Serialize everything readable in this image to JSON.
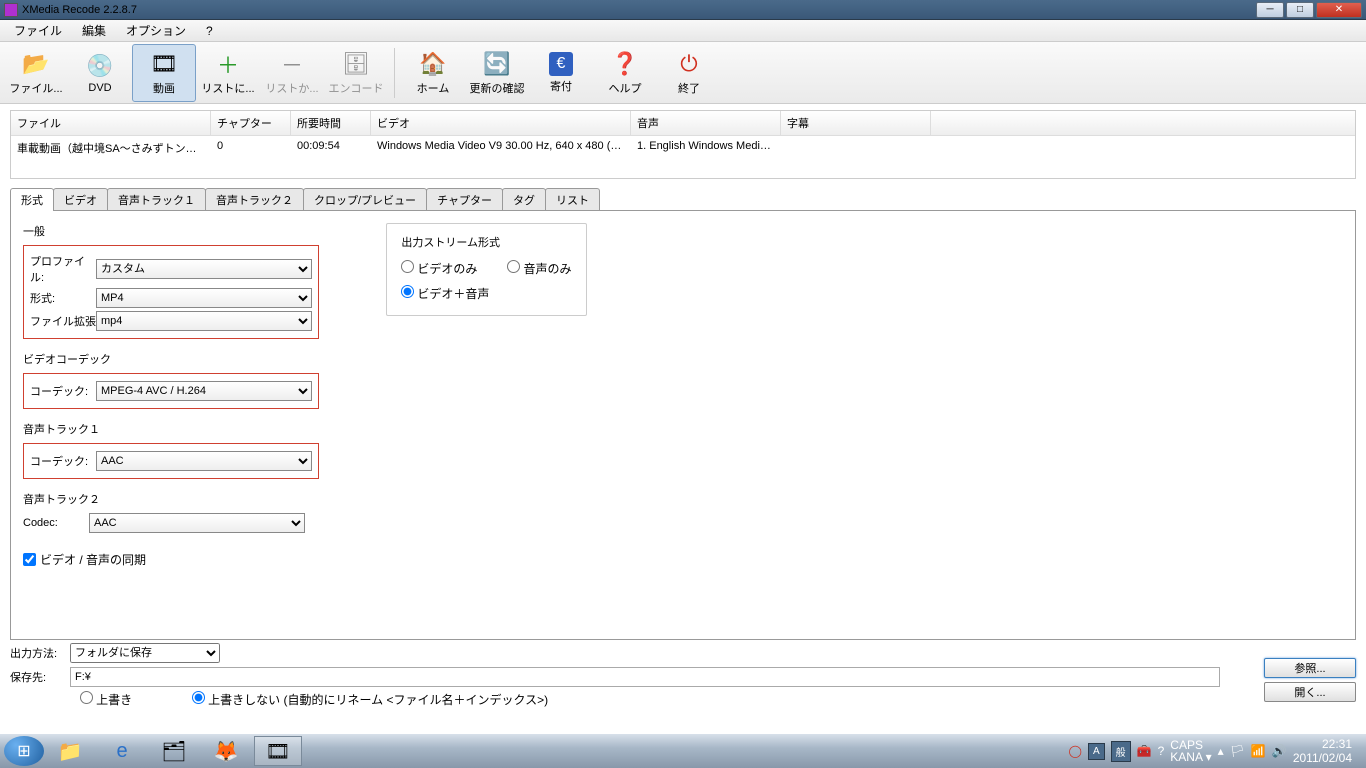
{
  "titlebar": {
    "title": "XMedia Recode 2.2.8.7"
  },
  "menu": {
    "file": "ファイル",
    "edit": "編集",
    "options": "オプション",
    "help": "?"
  },
  "toolbar": {
    "file": "ファイル...",
    "dvd": "DVD",
    "movie": "動画",
    "addlist": "リストに...",
    "removelist": "リストか...",
    "encode": "エンコード",
    "home": "ホーム",
    "update": "更新の確認",
    "donate": "寄付",
    "help": "ヘルプ",
    "exit": "終了"
  },
  "filelist": {
    "headers": {
      "file": "ファイル",
      "chapter": "チャプター",
      "time": "所要時間",
      "video": "ビデオ",
      "audio": "音声",
      "subs": "字幕"
    },
    "rows": [
      {
        "file": "車載動画（越中境SA～さみずトンネ...",
        "chapter": "0",
        "time": "00:09:54",
        "video": "Windows Media Video V9 30.00 Hz, 640 x 480 (1...",
        "audio": "1. English Windows Media ...",
        "subs": ""
      }
    ]
  },
  "tabs": {
    "format": "形式",
    "video": "ビデオ",
    "atrack1": "音声トラック１",
    "atrack2": "音声トラック２",
    "crop": "クロップ/プレビュー",
    "chapter": "チャプター",
    "tag": "タグ",
    "list": "リスト"
  },
  "format_panel": {
    "general_title": "一般",
    "profile_label": "プロファイル:",
    "profile_value": "カスタム",
    "format_label": "形式:",
    "format_value": "MP4",
    "ext_label": "ファイル拡張",
    "ext_value": "mp4",
    "vcodec_title": "ビデオコーデック",
    "codec_label": "コーデック:",
    "vcodec_value": "MPEG-4 AVC / H.264",
    "atrack1_title": "音声トラック１",
    "acodec1_value": "AAC",
    "atrack2_title": "音声トラック２",
    "codec2_label": "Codec:",
    "acodec2_value": "AAC",
    "sync_label": "ビデオ / 音声の同期",
    "stream_title": "出力ストリーム形式",
    "stream_video_only": "ビデオのみ",
    "stream_audio_only": "音声のみ",
    "stream_both": "ビデオ＋音声"
  },
  "output": {
    "method_label": "出力方法:",
    "method_value": "フォルダに保存",
    "dest_label": "保存先:",
    "dest_value": "F:¥",
    "browse": "参照...",
    "open": "開く...",
    "overwrite": "上書き",
    "no_overwrite": "上書きしない (自動的にリネーム <ファイル名＋インデックス>)"
  },
  "taskbar": {
    "lang_a": "A",
    "lang_b": "般",
    "caps": "CAPS",
    "kana": "KANA ▾",
    "time": "22:31",
    "date": "2011/02/04"
  }
}
